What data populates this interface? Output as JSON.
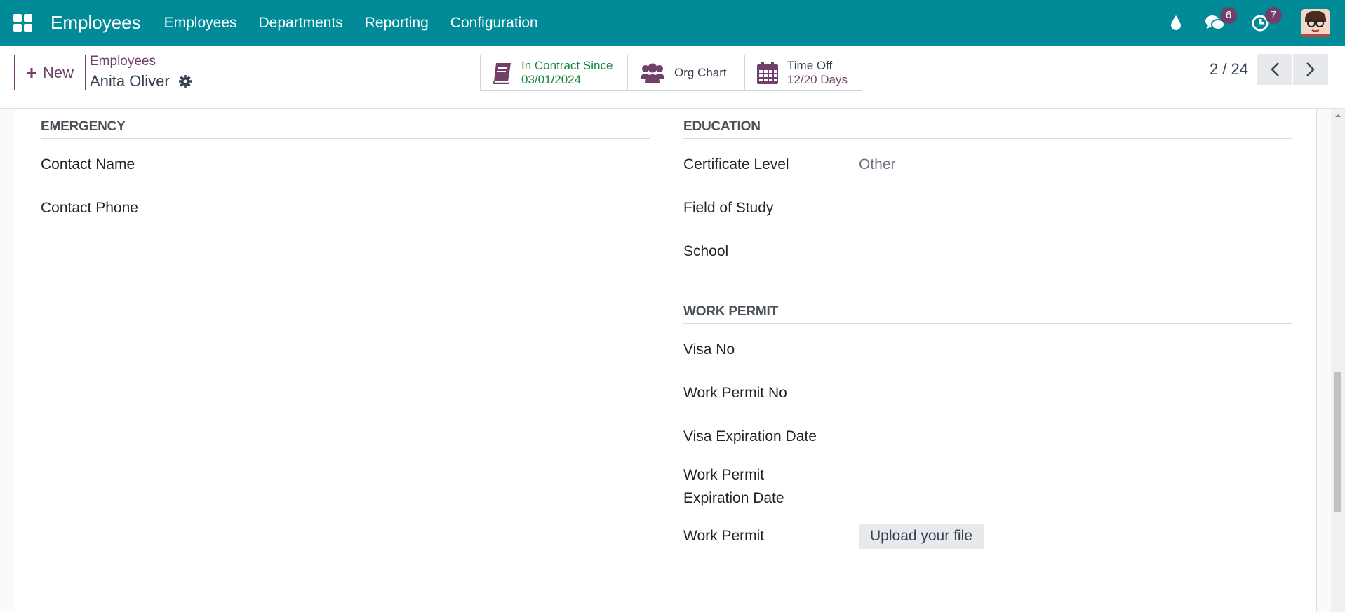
{
  "topbar": {
    "app_name": "Employees",
    "menu": [
      "Employees",
      "Departments",
      "Reporting",
      "Configuration"
    ],
    "messages_count": "6",
    "activities_count": "7"
  },
  "control": {
    "new_label": "New",
    "breadcrumb": "Employees",
    "record_name": "Anita Oliver",
    "smart_buttons": {
      "contract_line1": "In Contract Since",
      "contract_line2": "03/01/2024",
      "org_chart": "Org Chart",
      "timeoff_line1": "Time Off",
      "timeoff_line2": "12/20 Days"
    },
    "pager": "2 / 24"
  },
  "emergency": {
    "title": "EMERGENCY",
    "contact_name_label": "Contact Name",
    "contact_phone_label": "Contact Phone"
  },
  "education": {
    "title": "EDUCATION",
    "certificate_label": "Certificate Level",
    "certificate_value": "Other",
    "field_label": "Field of Study",
    "school_label": "School"
  },
  "work_permit": {
    "title": "WORK PERMIT",
    "visa_no_label": "Visa No",
    "permit_no_label": "Work Permit No",
    "visa_exp_label": "Visa Expiration Date",
    "permit_exp_label_line1": "Work Permit",
    "permit_exp_label_line2": "Expiration Date",
    "permit_label": "Work Permit",
    "upload_label": "Upload your file"
  },
  "colors": {
    "topbar": "#018a98",
    "brand": "#71406a",
    "contract_green": "#16843b"
  }
}
